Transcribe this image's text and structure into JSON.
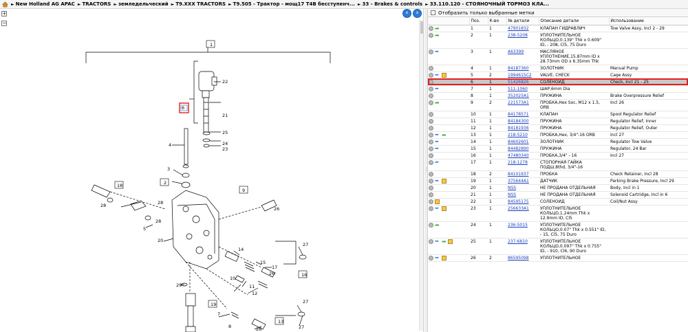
{
  "breadcrumb": {
    "segments": [
      "New Holland AG APAC",
      "TRACTORS",
      "земледельческий",
      "T9.XXX TRACTORS",
      "T9.505 - Трактор - мощ17 T4B бесступенч...",
      "33 - Brakes & controls",
      "33.110.120 - СТОЯНОЧНЫЙ ТОРМОЗ КЛА..."
    ]
  },
  "tools": {
    "zoom_in": "+",
    "zoom_out": "−"
  },
  "filter": {
    "label": "Отобразить только выбранные метки",
    "checked": false
  },
  "columns": {
    "pos": "Поз.",
    "qty": "К-во",
    "part": "№ детали",
    "desc": "Описание детали",
    "usage": "Использование"
  },
  "rows": [
    {
      "icons": [
        "circle",
        "green"
      ],
      "pos": "1",
      "qty": "1",
      "part": "47901832",
      "desc": "КЛАПАН ГИДРАВЛИЧ",
      "usage": "Tow Valve Assy, Incl 2 - 29"
    },
    {
      "icons": [
        "circle",
        "green"
      ],
      "pos": "2",
      "qty": "1",
      "part": "238-5208",
      "desc": "УПЛОТНИТЕЛЬНОЕ КОЛЬЦО,0.139\" Thk x 0.609\" ID, - 208, Cl5, 75 Duro",
      "usage": ""
    },
    {
      "icons": [
        "circle",
        "gear"
      ],
      "pos": "3",
      "qty": "1",
      "part": "A63399",
      "desc": "МАСЛЯНОЕ УПЛОТНЕНИЕ,15.87mm ID x 28.73mm OD x 6.35mm Thk",
      "usage": ""
    },
    {
      "icons": [
        "circle"
      ],
      "pos": "4",
      "qty": "1",
      "part": "84187360",
      "desc": "ЗОЛОТНИК",
      "usage": "Manual Pump"
    },
    {
      "icons": [
        "circle",
        "gear",
        "box"
      ],
      "pos": "5",
      "qty": "2",
      "part": "1994615C2",
      "desc": "VALVE, CHECK",
      "usage": "Cage Assy"
    },
    {
      "icons": [
        "circle"
      ],
      "pos": "6",
      "qty": "1",
      "part": "51426826",
      "desc": "СОЛЕНОИД",
      "usage": "Check, Incl 21 - 25",
      "selected": true
    },
    {
      "icons": [
        "circle",
        "gear"
      ],
      "pos": "7",
      "qty": "1",
      "part": "511-1060",
      "desc": "ШАР,6mm Dia",
      "usage": ""
    },
    {
      "icons": [
        "circle"
      ],
      "pos": "8",
      "qty": "1",
      "part": "352025A1",
      "desc": "ПРУЖИНА",
      "usage": "Brake Overpressure Relief"
    },
    {
      "icons": [
        "circle",
        "green"
      ],
      "pos": "9",
      "qty": "2",
      "part": "221573A1",
      "desc": "ПРОБКА,Hex Soc, M12 x 1.5, ORB",
      "usage": "Incl 26"
    },
    {
      "icons": [
        "circle"
      ],
      "pos": "10",
      "qty": "1",
      "part": "84178571",
      "desc": "КЛАПАН",
      "usage": "Spool Regulator Relief"
    },
    {
      "icons": [
        "circle"
      ],
      "pos": "11",
      "qty": "1",
      "part": "84184300",
      "desc": "ПРУЖИНА",
      "usage": "Regulator Relief, Inner"
    },
    {
      "icons": [
        "circle"
      ],
      "pos": "12",
      "qty": "1",
      "part": "84181936",
      "desc": "ПРУЖИНА",
      "usage": "Regulator Relief, Outer"
    },
    {
      "icons": [
        "circle",
        "gear",
        "green"
      ],
      "pos": "13",
      "qty": "1",
      "part": "218-5210",
      "desc": "ПРОБКА,Hex, 3/4\"-16 ORB",
      "usage": "Incl 27"
    },
    {
      "icons": [
        "circle",
        "gear"
      ],
      "pos": "14",
      "qty": "1",
      "part": "84602601",
      "desc": "ЗОЛОТНИК",
      "usage": "Regulator Tow Valve"
    },
    {
      "icons": [
        "circle",
        "gear"
      ],
      "pos": "15",
      "qty": "1",
      "part": "84482890",
      "desc": "ПРУЖИНА",
      "usage": "Regulator, 24 Bar"
    },
    {
      "icons": [
        "circle"
      ],
      "pos": "16",
      "qty": "1",
      "part": "47480340",
      "desc": "ПРОБКА,3/4\" - 16",
      "usage": "Incl 27"
    },
    {
      "icons": [
        "circle",
        "gear"
      ],
      "pos": "17",
      "qty": "1",
      "part": "218-1278",
      "desc": "СТОПОРНАЯ ГАЙКА ПОДШ,8thd, 3/4\"-16",
      "usage": ""
    },
    {
      "icons": [
        "circle"
      ],
      "pos": "18",
      "qty": "2",
      "part": "84101937",
      "desc": "ПРОБКА",
      "usage": "Check Retainer, Incl 28"
    },
    {
      "icons": [
        "circle",
        "gear",
        "box"
      ],
      "pos": "19",
      "qty": "1",
      "part": "375644A1",
      "desc": "ДАТЧИК",
      "usage": "Parking Brake Pressure, Incl 29"
    },
    {
      "icons": [
        "circle"
      ],
      "pos": "20",
      "qty": "1",
      "part": "NSS",
      "desc": "НЕ ПРОДАНА ОТДЕЛЬНАЯ",
      "usage": "Body, Incl in 1"
    },
    {
      "icons": [
        "circle"
      ],
      "pos": "21",
      "qty": "1",
      "part": "NSS",
      "desc": "НЕ ПРОДАНА ОТДЕЛЬНАЯ",
      "usage": "Solenoid Cartridge, Incl in 6"
    },
    {
      "icons": [
        "circle",
        "box"
      ],
      "pos": "22",
      "qty": "1",
      "part": "84595175",
      "desc": "СОЛЕНОИД",
      "usage": "Coil/Nut Assy"
    },
    {
      "icons": [
        "circle",
        "gear",
        "box"
      ],
      "pos": "23",
      "qty": "1",
      "part": "256633A1",
      "desc": "УПЛОТНИТЕЛЬНОЕ КОЛЬЦО,1.24mm Thk x 12.9mm ID, Cl5",
      "usage": ""
    },
    {
      "icons": [
        "circle",
        "green"
      ],
      "pos": "24",
      "qty": "1",
      "part": "236-5015",
      "desc": "УПЛОТНИТЕЛЬНОЕ КОЛЬЦО,0.07\" Thk x 0.551\" ID, - 15, Cl5, 75 Duro",
      "usage": ""
    },
    {
      "icons": [
        "circle",
        "gear",
        "green",
        "box"
      ],
      "pos": "25",
      "qty": "1",
      "part": "237-6810",
      "desc": "УПЛОТНИТЕЛЬНОЕ КОЛЬЦО,0.097\" Thk x 0.755\" ID, - 910, Cl6, 90 Duro",
      "usage": ""
    },
    {
      "icons": [
        "circle",
        "gear",
        "box"
      ],
      "pos": "26",
      "qty": "2",
      "part": "86595098",
      "desc": "УПЛОТНИТЕЛЬНОЕ",
      "usage": ""
    }
  ],
  "diagram": {
    "callouts": [
      "1",
      "2",
      "3",
      "4",
      "5",
      "6",
      "7",
      "8",
      "9",
      "10",
      "11",
      "12",
      "13",
      "14",
      "15",
      "16",
      "17",
      "18",
      "19",
      "20",
      "21",
      "22",
      "23",
      "24",
      "25",
      "26",
      "26",
      "26",
      "27",
      "27",
      "27",
      "28",
      "28",
      "28",
      "29"
    ],
    "box_labels": [
      "1",
      "2",
      "6",
      "8",
      "9",
      "13",
      "16",
      "18",
      "19"
    ]
  },
  "colors": {
    "highlight": "#e41e1e",
    "link": "#1a3fbf",
    "nav_blue": "#2f7bd6"
  }
}
